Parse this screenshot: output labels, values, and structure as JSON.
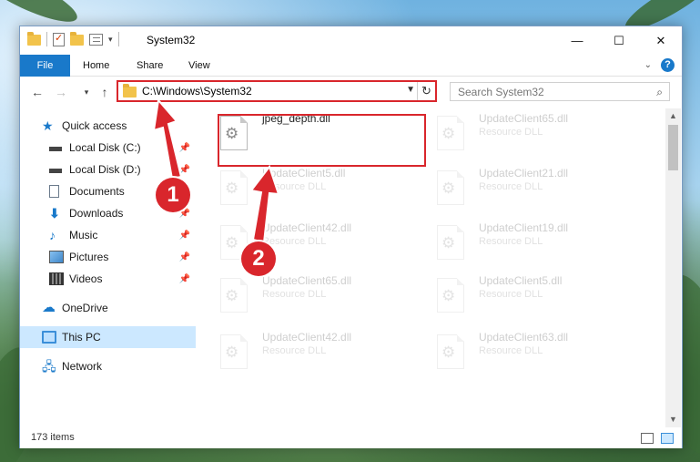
{
  "window": {
    "title": "System32",
    "controls": [
      "—",
      "☐",
      "✕"
    ]
  },
  "ribbon": {
    "tabs": [
      "File",
      "Home",
      "Share",
      "View"
    ],
    "help": "?"
  },
  "address": {
    "path": "C:\\Windows\\System32",
    "search_placeholder": "Search System32"
  },
  "nav": {
    "quick_access": "Quick access",
    "items": [
      {
        "label": "Local Disk (C:)",
        "icon": "disk-icon"
      },
      {
        "label": "Local Disk (D:)",
        "icon": "disk-icon"
      },
      {
        "label": "Documents",
        "icon": "documents-icon"
      },
      {
        "label": "Downloads",
        "icon": "downloads-icon"
      },
      {
        "label": "Music",
        "icon": "music-icon"
      },
      {
        "label": "Pictures",
        "icon": "pictures-icon"
      },
      {
        "label": "Videos",
        "icon": "videos-icon"
      }
    ],
    "onedrive": "OneDrive",
    "this_pc": "This PC",
    "network": "Network"
  },
  "files": [
    {
      "name": "jpeg_depth.dll",
      "type": ""
    },
    {
      "name": "UpdateClient65.dll",
      "type": "Resource DLL"
    },
    {
      "name": "UpdateClient5.dll",
      "type": "Resource DLL"
    },
    {
      "name": "UpdateClient21.dll",
      "type": "Resource DLL"
    },
    {
      "name": "UpdateClient42.dll",
      "type": "Resource DLL"
    },
    {
      "name": "UpdateClient19.dll",
      "type": "Resource DLL"
    },
    {
      "name": "UpdateClient65.dll",
      "type": "Resource DLL"
    },
    {
      "name": "UpdateClient5.dll",
      "type": "Resource DLL"
    },
    {
      "name": "UpdateClient42.dll",
      "type": "Resource DLL"
    },
    {
      "name": "UpdateClient63.dll",
      "type": "Resource DLL"
    }
  ],
  "status": {
    "items": "173 items"
  },
  "annotations": {
    "step1": "1",
    "step2": "2"
  },
  "colors": {
    "accent": "#1979ca",
    "highlight": "#d9262c",
    "selected": "#cce8ff"
  }
}
